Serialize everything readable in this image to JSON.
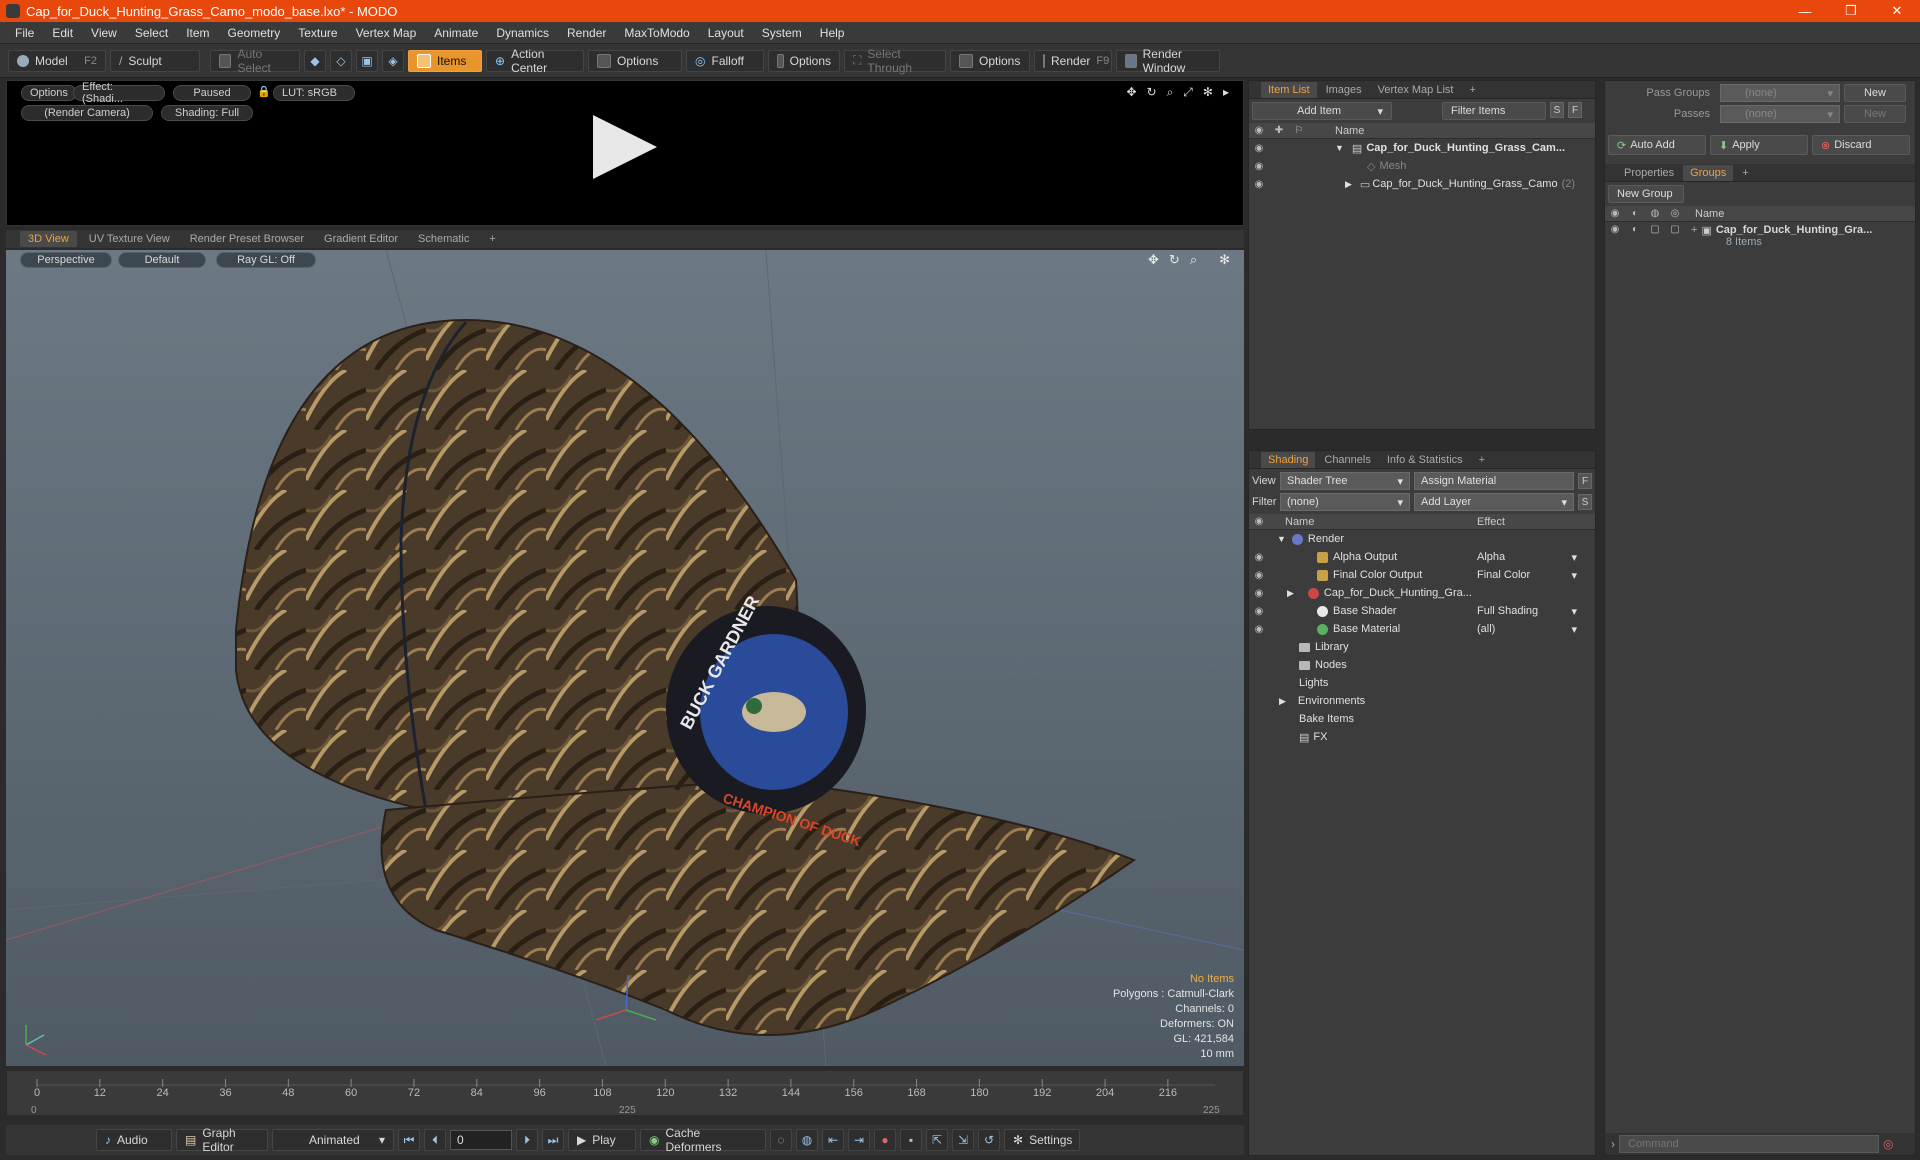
{
  "window": {
    "title": "Cap_for_Duck_Hunting_Grass_Camo_modo_base.lxo* - MODO",
    "controls": [
      "—",
      "❐",
      "✕"
    ]
  },
  "menu": [
    "File",
    "Edit",
    "View",
    "Select",
    "Item",
    "Geometry",
    "Texture",
    "Vertex Map",
    "Animate",
    "Dynamics",
    "Render",
    "MaxToModo",
    "Layout",
    "System",
    "Help"
  ],
  "toolbar": {
    "model": "Model",
    "model_key": "F2",
    "sculpt": "Sculpt",
    "auto_select": "Auto Select",
    "items": "Items",
    "action_center": "Action Center",
    "options1": "Options",
    "falloff": "Falloff",
    "options2": "Options",
    "select_through": "Select Through",
    "options3": "Options",
    "render": "Render",
    "render_key": "F9",
    "render_window": "Render Window"
  },
  "preview": {
    "options": "Options",
    "effect": "Effect: (Shadi...",
    "paused": "Paused",
    "lut": "LUT: sRGB",
    "camera": "(Render Camera)",
    "shading": "Shading: Full"
  },
  "viewport_tabs": [
    "3D View",
    "UV Texture View",
    "Render Preset Browser",
    "Gradient Editor",
    "Schematic",
    "+"
  ],
  "viewport": {
    "perspective": "Perspective",
    "default": "Default",
    "raygl": "Ray GL: Off",
    "patch_top": "BUCK GARDNER",
    "patch_bottom": "CHAMPION OF DUCK",
    "stats": {
      "items": "No Items",
      "polygons": "Polygons : Catmull-Clark",
      "channels": "Channels: 0",
      "deformers": "Deformers: ON",
      "gl": "GL: 421,584",
      "scale": "10 mm"
    }
  },
  "timeline": {
    "labels": [
      "0",
      "12",
      "24",
      "36",
      "48",
      "60",
      "72",
      "84",
      "96",
      "108",
      "120",
      "132",
      "144",
      "156",
      "168",
      "180",
      "192",
      "204",
      "216"
    ],
    "sub_start": "0",
    "sub_mid": "225",
    "sub_end": "225"
  },
  "bottom": {
    "audio": "Audio",
    "graph_editor": "Graph Editor",
    "animated": "Animated",
    "frame": "0",
    "play": "Play",
    "cache_deformers": "Cache Deformers",
    "settings": "Settings"
  },
  "item_list": {
    "tabs": [
      "Item List",
      "Images",
      "Vertex Map List",
      "+"
    ],
    "add_item": "Add Item",
    "filter_items": "Filter Items",
    "s": "S",
    "f": "F",
    "col_name": "Name",
    "rows": [
      {
        "name": "Cap_for_Duck_Hunting_Grass_Cam...",
        "style": "bold"
      },
      {
        "name": "Mesh",
        "style": "muted"
      },
      {
        "name": "Cap_for_Duck_Hunting_Grass_Camo",
        "count": "(2)"
      }
    ]
  },
  "shading": {
    "tabs": [
      "Shading",
      "Channels",
      "Info & Statistics",
      "+"
    ],
    "view_label": "View",
    "view_value": "Shader Tree",
    "assign_material": "Assign Material",
    "filter_label": "Filter",
    "filter_value": "(none)",
    "add_layer": "Add Layer",
    "f": "F",
    "s": "S",
    "col_name": "Name",
    "col_effect": "Effect",
    "rows": [
      {
        "name": "Render",
        "effect": ""
      },
      {
        "name": "Alpha Output",
        "effect": "Alpha"
      },
      {
        "name": "Final Color Output",
        "effect": "Final Color"
      },
      {
        "name": "Cap_for_Duck_Hunting_Gra...",
        "effect": ""
      },
      {
        "name": "Base Shader",
        "effect": "Full Shading"
      },
      {
        "name": "Base Material",
        "effect": "(all)"
      },
      {
        "name": "Library",
        "effect": ""
      },
      {
        "name": "Nodes",
        "effect": ""
      },
      {
        "name": "Lights",
        "effect": ""
      },
      {
        "name": "Environments",
        "effect": ""
      },
      {
        "name": "Bake Items",
        "effect": ""
      },
      {
        "name": "FX",
        "effect": ""
      }
    ]
  },
  "groups_panel": {
    "pass_groups_label": "Pass Groups",
    "pass_groups_value": "(none)",
    "passes_label": "Passes",
    "passes_value": "(none)",
    "new1": "New",
    "new2": "New",
    "auto_add": "Auto Add",
    "apply": "Apply",
    "discard": "Discard",
    "tabs": [
      "Properties",
      "Groups",
      "+"
    ],
    "new_group": "New Group",
    "col_name": "Name",
    "group_name": "Cap_for_Duck_Hunting_Gra...",
    "group_items": "8 Items",
    "command_placeholder": "Command"
  },
  "colors": {
    "title_bar": "#e8480c",
    "accent": "#f0a040",
    "viewport_bg": "#5f6b75"
  }
}
